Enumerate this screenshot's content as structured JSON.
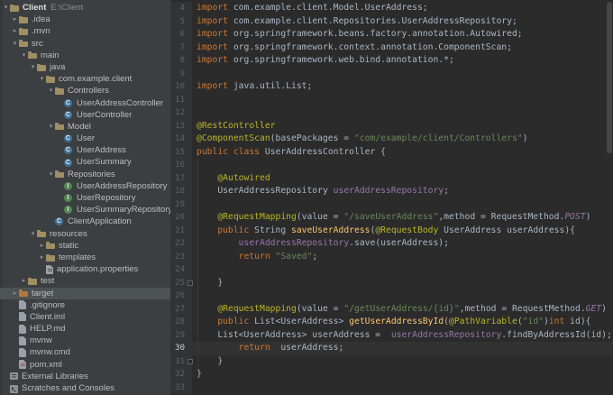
{
  "colors": {
    "editor_bg": "#2b2b2b",
    "gutter_bg": "#313335",
    "panel_bg": "#3c3f41",
    "selection_bg": "#4d5254",
    "keyword": "#cc7832",
    "string": "#6a8759",
    "annotation": "#bbb529",
    "field": "#9876aa",
    "method": "#ffc66d",
    "constant": "#9876aa",
    "line_number": "#606366",
    "text": "#a9b7c6"
  },
  "project_tree": {
    "items": [
      {
        "depth": 0,
        "icon": "folder",
        "chevron": "down",
        "label": "Client",
        "sub": "E:\\Client",
        "bold": true
      },
      {
        "depth": 1,
        "icon": "folder",
        "chevron": "right",
        "label": ".idea"
      },
      {
        "depth": 1,
        "icon": "folder",
        "chevron": "right",
        "label": ".mvn"
      },
      {
        "depth": 1,
        "icon": "folder",
        "chevron": "down",
        "label": "src"
      },
      {
        "depth": 2,
        "icon": "folder",
        "chevron": "down",
        "label": "main"
      },
      {
        "depth": 3,
        "icon": "folder",
        "chevron": "down",
        "label": "java"
      },
      {
        "depth": 4,
        "icon": "package",
        "chevron": "down",
        "label": "com.example.client"
      },
      {
        "depth": 5,
        "icon": "package",
        "chevron": "down",
        "label": "Controllers"
      },
      {
        "depth": 6,
        "icon": "class",
        "label": "UserAddressController"
      },
      {
        "depth": 6,
        "icon": "class",
        "label": "UserController"
      },
      {
        "depth": 5,
        "icon": "package",
        "chevron": "down",
        "label": "Model"
      },
      {
        "depth": 6,
        "icon": "class",
        "label": "User"
      },
      {
        "depth": 6,
        "icon": "class",
        "label": "UserAddress"
      },
      {
        "depth": 6,
        "icon": "class",
        "label": "UserSummary"
      },
      {
        "depth": 5,
        "icon": "package",
        "chevron": "down",
        "label": "Repositories"
      },
      {
        "depth": 6,
        "icon": "interface",
        "label": "UserAddressRepository"
      },
      {
        "depth": 6,
        "icon": "interface",
        "label": "UserRepository"
      },
      {
        "depth": 6,
        "icon": "interface",
        "label": "UserSummaryRepository"
      },
      {
        "depth": 5,
        "icon": "class",
        "label": "ClientApplication"
      },
      {
        "depth": 3,
        "icon": "folder",
        "chevron": "down",
        "label": "resources"
      },
      {
        "depth": 4,
        "icon": "folder",
        "chevron": "right",
        "label": "static"
      },
      {
        "depth": 4,
        "icon": "folder",
        "chevron": "right",
        "label": "templates"
      },
      {
        "depth": 4,
        "icon": "file-props",
        "label": "application.properties"
      },
      {
        "depth": 2,
        "icon": "folder",
        "chevron": "right",
        "label": "test"
      },
      {
        "depth": 1,
        "icon": "folder-excluded",
        "chevron": "right",
        "label": "target",
        "selected": true
      },
      {
        "depth": 1,
        "icon": "file",
        "label": ".gitignore"
      },
      {
        "depth": 1,
        "icon": "file",
        "label": "Client.iml"
      },
      {
        "depth": 1,
        "icon": "file",
        "label": "HELP.md"
      },
      {
        "depth": 1,
        "icon": "file",
        "label": "mvnw"
      },
      {
        "depth": 1,
        "icon": "file",
        "label": "mvnw.cmd"
      },
      {
        "depth": 1,
        "icon": "file-xml",
        "label": "pom.xml"
      },
      {
        "depth": 0,
        "icon": "library",
        "label": "External Libraries"
      },
      {
        "depth": 0,
        "icon": "console",
        "label": "Scratches and Consoles"
      }
    ]
  },
  "editor": {
    "caret_line": 30,
    "fold_marks": [
      25,
      31
    ],
    "lines": [
      {
        "n": 4,
        "tk": [
          [
            "kw",
            "import "
          ],
          [
            "def",
            "com.example.client.Model.UserAddress;"
          ]
        ]
      },
      {
        "n": 5,
        "tk": [
          [
            "kw",
            "import "
          ],
          [
            "def",
            "com.example.client.Repositories.UserAddressRepository;"
          ]
        ]
      },
      {
        "n": 6,
        "tk": [
          [
            "kw",
            "import "
          ],
          [
            "def",
            "org.springframework.beans.factory.annotation.Autowired;"
          ]
        ]
      },
      {
        "n": 7,
        "tk": [
          [
            "kw",
            "import "
          ],
          [
            "def",
            "org.springframework.context.annotation.ComponentScan;"
          ]
        ]
      },
      {
        "n": 8,
        "tk": [
          [
            "kw",
            "import "
          ],
          [
            "def",
            "org.springframework.web.bind.annotation.*;"
          ]
        ]
      },
      {
        "n": 9,
        "tk": []
      },
      {
        "n": 10,
        "tk": [
          [
            "kw",
            "import "
          ],
          [
            "def",
            "java.util.List;"
          ]
        ]
      },
      {
        "n": 11,
        "tk": []
      },
      {
        "n": 12,
        "tk": []
      },
      {
        "n": 13,
        "tk": [
          [
            "ann",
            "@RestController"
          ]
        ]
      },
      {
        "n": 14,
        "tk": [
          [
            "ann",
            "@ComponentScan"
          ],
          [
            "def",
            "(basePackages = "
          ],
          [
            "str",
            "\"com/example/client/Controllers\""
          ],
          [
            "def",
            ")"
          ]
        ]
      },
      {
        "n": 15,
        "tk": [
          [
            "kw",
            "public class "
          ],
          [
            "def",
            "UserAddressController {"
          ]
        ]
      },
      {
        "n": 16,
        "tk": []
      },
      {
        "n": 17,
        "tk": [
          [
            "def",
            "    "
          ],
          [
            "ann",
            "@Autowired"
          ]
        ]
      },
      {
        "n": 18,
        "tk": [
          [
            "def",
            "    UserAddressRepository "
          ],
          [
            "fld",
            "userAddressRepository"
          ],
          [
            "def",
            ";"
          ]
        ]
      },
      {
        "n": 19,
        "tk": []
      },
      {
        "n": 20,
        "tk": [
          [
            "def",
            "    "
          ],
          [
            "ann",
            "@RequestMapping"
          ],
          [
            "def",
            "(value = "
          ],
          [
            "str",
            "\"/saveUserAddress\""
          ],
          [
            "def",
            ",method = RequestMethod."
          ],
          [
            "cnst",
            "POST"
          ],
          [
            "def",
            ")"
          ]
        ]
      },
      {
        "n": 21,
        "tk": [
          [
            "def",
            "    "
          ],
          [
            "kw",
            "public "
          ],
          [
            "def",
            "String "
          ],
          [
            "mth",
            "saveUserAddress"
          ],
          [
            "def",
            "("
          ],
          [
            "ann",
            "@RequestBody"
          ],
          [
            "def",
            " UserAddress userAddress){"
          ]
        ]
      },
      {
        "n": 22,
        "tk": [
          [
            "def",
            "        "
          ],
          [
            "fld",
            "userAddressRepository"
          ],
          [
            "def",
            ".save(userAddress);"
          ]
        ]
      },
      {
        "n": 23,
        "tk": [
          [
            "def",
            "        "
          ],
          [
            "kw",
            "return "
          ],
          [
            "str",
            "\"Saved\""
          ],
          [
            "def",
            ";"
          ]
        ]
      },
      {
        "n": 24,
        "tk": []
      },
      {
        "n": 25,
        "tk": [
          [
            "def",
            "    }"
          ]
        ]
      },
      {
        "n": 26,
        "tk": []
      },
      {
        "n": 27,
        "tk": [
          [
            "def",
            "    "
          ],
          [
            "ann",
            "@RequestMapping"
          ],
          [
            "def",
            "(value = "
          ],
          [
            "str",
            "\"/getUserAddress/{id}\""
          ],
          [
            "def",
            ",method = RequestMethod."
          ],
          [
            "cnst",
            "GET"
          ],
          [
            "def",
            ")"
          ]
        ]
      },
      {
        "n": 28,
        "tk": [
          [
            "def",
            "    "
          ],
          [
            "kw",
            "public "
          ],
          [
            "def",
            "List<UserAddress> "
          ],
          [
            "mth",
            "getUserAddressById"
          ],
          [
            "def",
            "("
          ],
          [
            "ann",
            "@PathVariable"
          ],
          [
            "def",
            "("
          ],
          [
            "str",
            "\"id\""
          ],
          [
            "def",
            ")"
          ],
          [
            "kw",
            "int"
          ],
          [
            "def",
            " id){"
          ]
        ]
      },
      {
        "n": 29,
        "tk": [
          [
            "def",
            "    List<UserAddress> userAddress =  "
          ],
          [
            "fld",
            "userAddressRepository"
          ],
          [
            "def",
            ".findByAddressId(id);"
          ]
        ]
      },
      {
        "n": 30,
        "tk": [
          [
            "def",
            "        "
          ],
          [
            "kw",
            "return  "
          ],
          [
            "def",
            "userAddress;"
          ]
        ]
      },
      {
        "n": 31,
        "tk": [
          [
            "def",
            "    }"
          ]
        ]
      },
      {
        "n": 32,
        "tk": [
          [
            "def",
            "}"
          ]
        ]
      },
      {
        "n": 33,
        "tk": []
      }
    ]
  }
}
